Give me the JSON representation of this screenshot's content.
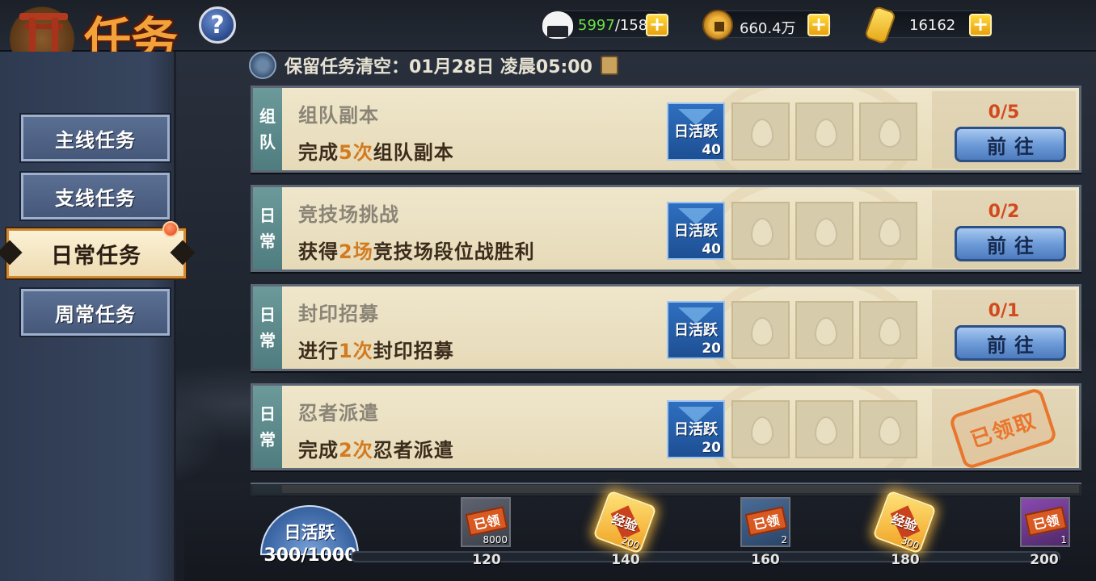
{
  "header": {
    "title": "任务",
    "help_label": "?",
    "resources": [
      {
        "icon": "rice-ball-icon",
        "current": "5997",
        "separator_max": "/158"
      },
      {
        "icon": "copper-coin-icon",
        "value": "660.4万"
      },
      {
        "icon": "gold-ingot-icon",
        "value": "16162"
      }
    ],
    "plus_label": "+"
  },
  "sidebar": {
    "items": [
      {
        "label": "主线任务",
        "active": false
      },
      {
        "label": "支线任务",
        "active": false
      },
      {
        "label": "日常任务",
        "active": true
      },
      {
        "label": "周常任务",
        "active": false
      }
    ]
  },
  "notice": {
    "text": "保留任务清空：01月28日  凌晨05:00"
  },
  "reward_label": "日活跃",
  "tasks": [
    {
      "tag": [
        "组",
        "队"
      ],
      "name": "组队副本",
      "desc_pre": "完成",
      "desc_hl": "5次",
      "desc_post": "组队副本",
      "reward": "40",
      "progress": "0/5",
      "action": "前往",
      "claimed": false
    },
    {
      "tag": [
        "日",
        "常"
      ],
      "name": "竞技场挑战",
      "desc_pre": "获得",
      "desc_hl": "2场",
      "desc_post": "竞技场段位战胜利",
      "reward": "40",
      "progress": "0/2",
      "action": "前往",
      "claimed": false
    },
    {
      "tag": [
        "日",
        "常"
      ],
      "name": "封印招募",
      "desc_pre": "进行",
      "desc_hl": "1次",
      "desc_post": "封印招募",
      "reward": "20",
      "progress": "0/1",
      "action": "前往",
      "claimed": false
    },
    {
      "tag": [
        "日",
        "常"
      ],
      "name": "忍者派遣",
      "desc_pre": "完成",
      "desc_hl": "2次",
      "desc_post": "忍者派遣",
      "reward": "20",
      "stamp": "已领取",
      "claimed": true
    }
  ],
  "activity": {
    "label": "日活跃",
    "total": "300/1000",
    "fill_fraction": 0.0,
    "milestones": [
      {
        "value": "120",
        "chest": "gray",
        "label": "已领",
        "count": "8000"
      },
      {
        "value": "140",
        "chest": "gold",
        "label": "经验",
        "count": "200"
      },
      {
        "value": "160",
        "chest": "blue",
        "label": "已领",
        "count": "2"
      },
      {
        "value": "180",
        "chest": "gold",
        "label": "经验",
        "count": "300"
      },
      {
        "value": "200",
        "chest": "purple",
        "label": "已领",
        "count": "1"
      }
    ]
  },
  "colors": {
    "accent_orange": "#d27b20",
    "progress_red": "#d3491e",
    "tag_teal": "#5a8a8c",
    "go_button_blue": "#6e9cd9"
  }
}
